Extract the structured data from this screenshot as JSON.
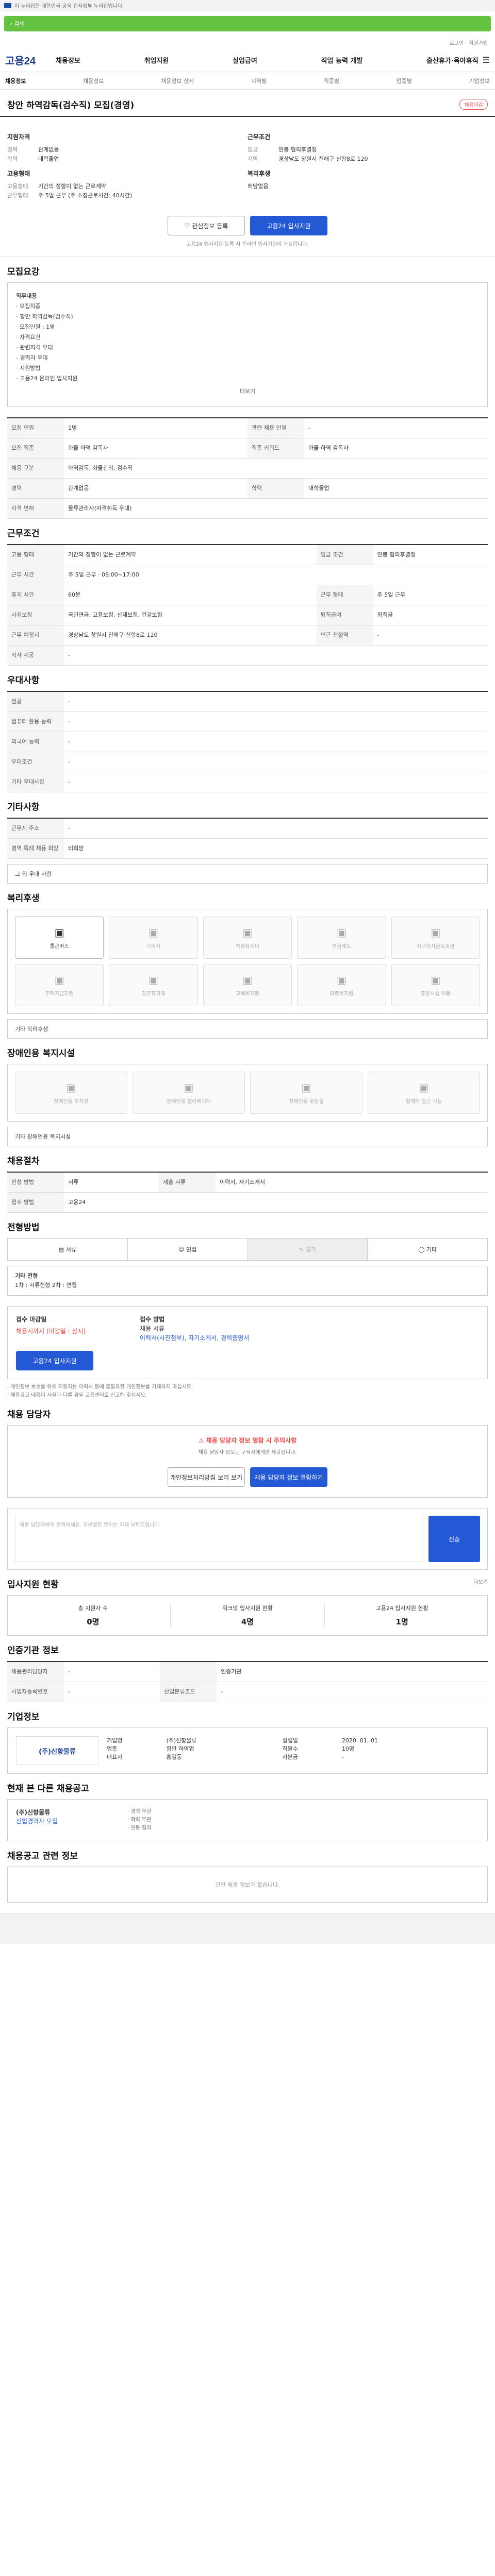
{
  "topbar": {
    "text": "이 누리집은 대한민국 공식 전자정부 누리집입니다."
  },
  "search": {
    "placeholder": "검색"
  },
  "util": [
    "로그인",
    "회원가입"
  ],
  "logo": "고용24",
  "gnb": [
    "채용정보",
    "취업지원",
    "실업급여",
    "직업 능력 개발",
    "출산휴가·육아휴직"
  ],
  "subnav": {
    "left": "채용정보",
    "items": [
      "채용정보",
      "채용정보 상세",
      "지역별",
      "직종별",
      "업종별",
      "기업정보"
    ]
  },
  "job": {
    "title": "창안 하역감독(검수직) 모집(경영)",
    "badge": "채용마감",
    "left_head": "지원자격",
    "career": {
      "k": "경력",
      "v": "관계없음"
    },
    "edu": {
      "k": "학력",
      "v": "대학졸업"
    },
    "cond_head": "고용형태",
    "employ": {
      "k": "고용형태",
      "v": "기간의 정함이 없는 근로계약"
    },
    "work": {
      "k": "근무형태",
      "v": "주 5일 근무 (주 소정근로시간: 40시간)"
    },
    "right_head": "근무조건",
    "pay": {
      "k": "임금",
      "v": "연봉 협의후결정"
    },
    "loc": {
      "k": "지역",
      "v": "경상남도 창원시 진해구 신항8로 120"
    },
    "head2": "복리후생",
    "welfare": "해당없음"
  },
  "buttons": {
    "scrap": "관심정보 등록",
    "apply": "고용24 입사지원"
  },
  "note": "고용24 입사지원 등록 시 온라인 입사지원이 가능합니다.",
  "s1": {
    "title": "모집요강",
    "sub": "직무내용",
    "items": [
      "· 모집직종",
      "- 항만 하역감독(검수직)",
      "· 모집인원 : 1명",
      "· 자격요건",
      "- 관련자격 우대",
      "- 경력자 우대",
      "· 지원방법",
      "- 고용24 온라인 입사지원"
    ],
    "more": "더보기"
  },
  "t1": [
    [
      "모집 인원",
      "1명",
      "관련 채용 인원",
      "-"
    ],
    [
      "모집 직종",
      "화물 하역 감독자",
      "직종 키워드",
      "화물 하역 감독자"
    ],
    [
      "채용 구분",
      "하역감독, 화물관리, 검수직",
      "",
      ""
    ],
    [
      "경력",
      "관계없음",
      "학력",
      "대학졸업"
    ],
    [
      "자격 면허",
      "물류관리사(자격취득 우대)",
      "",
      ""
    ]
  ],
  "s2": {
    "title": "근무조건"
  },
  "t2": [
    [
      "고용 형태",
      "기간의 정함이 없는 근로계약",
      "임금 조건",
      "연봉 협의후결정"
    ],
    [
      "근무 시간",
      "주 5일 근무 · 08:00~17:00",
      "",
      ""
    ],
    [
      "휴게 시간",
      "60분",
      "근무 형태",
      "주 5일 근무"
    ],
    [
      "사회보험",
      "국민연금, 고용보험, 산재보험, 건강보험",
      "퇴직급여",
      "퇴직금"
    ],
    [
      "근무 예정지",
      "경상남도 창원시 진해구 신항8로 120",
      "인근 전철역",
      "-"
    ],
    [
      "식사 제공",
      "-",
      "",
      ""
    ]
  ],
  "s3": {
    "title": "우대사항",
    "rows": [
      [
        "전공",
        "-"
      ],
      [
        "컴퓨터 활용 능력",
        "-"
      ],
      [
        "외국어 능력",
        "-"
      ],
      [
        "우대조건",
        "-"
      ],
      [
        "기타 우대사항",
        "-"
      ]
    ]
  },
  "s4": {
    "title": "기타사항",
    "rows": [
      [
        "근무지 주소",
        "-"
      ],
      [
        "병역 특례 채용 희망",
        "비희망"
      ]
    ],
    "extra": "그 외 우대 사항"
  },
  "s5": {
    "title": "복리후생",
    "tiles": [
      "통근버스",
      "기숙사",
      "차량유지비",
      "연금제도",
      "자녀학자금보조금",
      "주택자금지원",
      "경조휴가제",
      "교육비지원",
      "의료비지원",
      "휴양시설 이용"
    ],
    "other": "기타 복리후생"
  },
  "s6": {
    "title": "장애인용 복지시설",
    "tiles": [
      "장애인용 주차장",
      "장애인용 엘리베이터",
      "장애인용 화장실",
      "휠체어 접근 가능"
    ],
    "other": "기타 장애인용 복지시설"
  },
  "s7": {
    "title": "채용절차",
    "rows": [
      [
        "전형 방법",
        "서류",
        "제출 서류",
        "이력서, 자기소개서"
      ],
      [
        "접수 방법",
        "고용24",
        "",
        ""
      ]
    ]
  },
  "s8": {
    "title": "전형방법",
    "tabs": [
      "서류",
      "면접",
      "필기",
      "기타"
    ],
    "detail_head": "기타 전형",
    "detail": "1차 : 서류전형 2차 : 면접"
  },
  "s9": {
    "h1": "접수 마감일",
    "deadline": "채용시까지 (마감일 : 상시)",
    "h2": "접수 방법",
    "method": "채용 서류",
    "docs": "이력서(사진첨부), 자기소개서, 경력증명서",
    "apply": "고용24 입사지원",
    "notes": [
      "· 개인정보 보호를 위해 지원자는 이력서 등에 불필요한 개인정보를 기재하지 마십시오.",
      "· 채용공고 내용이 사실과 다를 경우 고용센터로 신고해 주십시오."
    ]
  },
  "s10": {
    "title": "채용 담당자",
    "warn_title": "채용 담당자 정보 열람 시 주의사항",
    "warn_text": "채용 담당자 정보는 구직자에게만 제공됩니다.",
    "b1": "개인정보처리방침 보러 보기",
    "b2": "채용 담당자 정보 열람하기"
  },
  "s11": {
    "placeholder": "채용 담당자에게 문의하세요. 무분별한 문의는 자제 부탁드립니다.",
    "send": "전송"
  },
  "s12": {
    "title": "입사지원 현황",
    "more": "더보기",
    "stats": [
      [
        "총 지원자 수",
        "0명"
      ],
      [
        "워크넷 입사지원 현황",
        "4명"
      ],
      [
        "고용24 입사지원 현황",
        "1명"
      ]
    ]
  },
  "s13": {
    "title": "인증기관 정보",
    "rows": [
      [
        "채용관리담당자",
        "-",
        "",
        "인증기관"
      ],
      [
        "사업자등록번호",
        "-",
        "산업분류코드",
        "-"
      ]
    ]
  },
  "s14": {
    "title": "기업정보",
    "name": "(주)신항물류",
    "rows": [
      [
        "기업명",
        "(주)신항물류",
        "설립일",
        "2020. 01. 01"
      ],
      [
        "업종",
        "항만 하역업",
        "직원수",
        "10명"
      ],
      [
        "대표자",
        "홍길동",
        "자본금",
        "-"
      ]
    ]
  },
  "s15": {
    "title": "현재 본 다른 채용공고",
    "company": "(주)신항물류",
    "job": "신입경력자 모집",
    "meta": [
      "· 경력 무관",
      "· 학력 무관",
      "· 연봉 협의"
    ]
  },
  "s16": {
    "title": "채용공고 관련 정보",
    "empty": "관련 채용 정보가 없습니다."
  },
  "colors": {
    "accent": "#2459d6",
    "green": "#63c341"
  }
}
